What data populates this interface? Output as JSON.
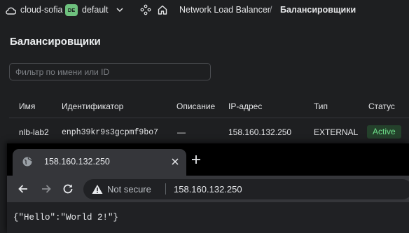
{
  "console": {
    "cloud_name": "cloud-sofia",
    "folder_badge": "DE",
    "folder_name": "default",
    "breadcrumb": [
      "Network Load Balancer",
      "/",
      "Балансировщики"
    ],
    "page_title": "Балансировщики",
    "filter_placeholder": "Фильтр по имени или ID",
    "table": {
      "columns": [
        "Имя",
        "Идентификатор",
        "Описание",
        "IP-адрес",
        "Тип",
        "Статус"
      ],
      "rows": [
        [
          "nlb-lab2",
          "enph39kr9s3gcpmf9bo7",
          "—",
          "158.160.132.250",
          "EXTERNAL",
          "Active"
        ]
      ]
    }
  },
  "browser": {
    "tab_title": "158.160.132.250",
    "security_label": "Not secure",
    "url": "158.160.132.250",
    "page_body": "{\"Hello\":\"World 2!\"}"
  },
  "colors": {
    "active_badge_bg": "#24412b",
    "active_badge_text": "#6ee08a",
    "folder_badge": "#6ec17e"
  },
  "icons": [
    "cloud-icon",
    "chevron-down-icon",
    "services-icon",
    "home-icon",
    "globe-icon",
    "close-icon",
    "plus-icon",
    "arrow-left-icon",
    "arrow-right-icon",
    "reload-icon",
    "warning-icon"
  ]
}
